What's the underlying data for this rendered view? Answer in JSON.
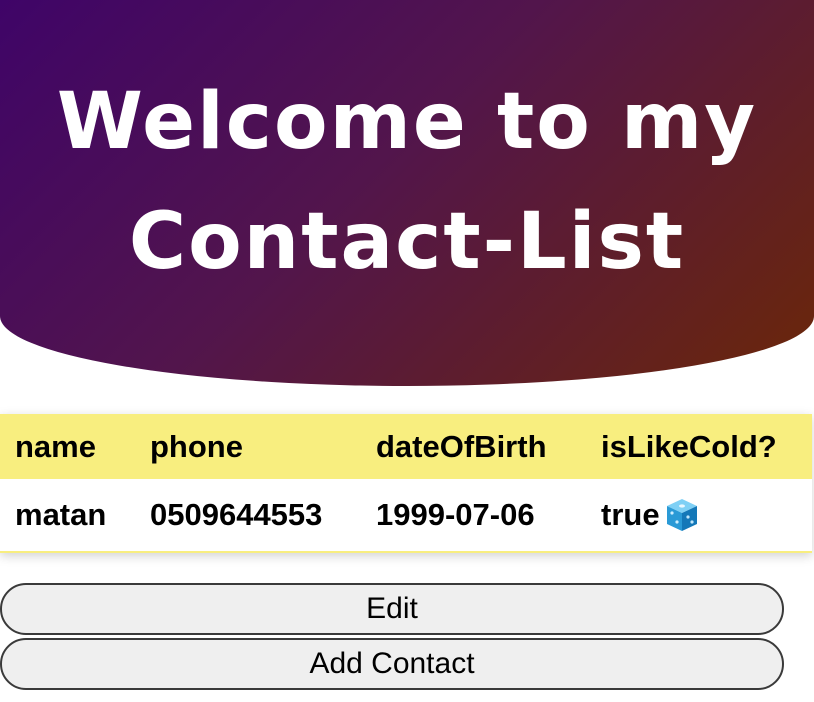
{
  "hero": {
    "title": "Welcome to my Contact-List",
    "gradient_colors": [
      "#3f0468",
      "#52154c",
      "#6b2708"
    ]
  },
  "table": {
    "header_color": "#f8ee7f",
    "columns": [
      "name",
      "phone",
      "dateOfBirth",
      "isLikeCold?"
    ],
    "rows": [
      {
        "name": "matan",
        "phone": "0509644553",
        "dateOfBirth": "1999-07-06",
        "isLikeCold": "true",
        "isLikeCold_icon": "ice-cube-icon"
      }
    ]
  },
  "buttons": {
    "edit_label": "Edit",
    "add_label": "Add Contact"
  }
}
